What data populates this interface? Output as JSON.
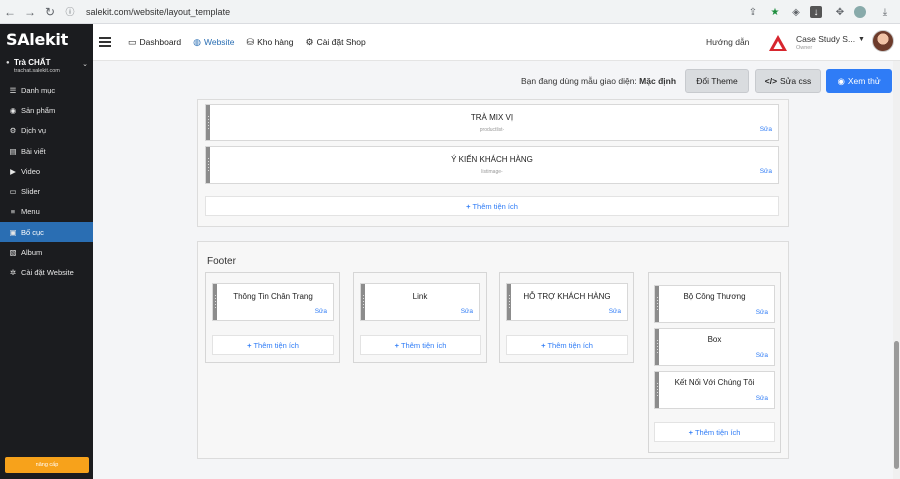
{
  "browser": {
    "url": "salekit.com/website/layout_template"
  },
  "sidebar": {
    "logo": "SAlekit",
    "shop_name": "Trà CHẤT",
    "shop_domain": "trachat.salekit.com",
    "items": [
      {
        "label": "Danh mục",
        "icon": "list-icon"
      },
      {
        "label": "Sản phẩm",
        "icon": "box-icon"
      },
      {
        "label": "Dịch vụ",
        "icon": "gear-icon"
      },
      {
        "label": "Bài viết",
        "icon": "document-icon"
      },
      {
        "label": "Video",
        "icon": "video-icon"
      },
      {
        "label": "Slider",
        "icon": "slider-icon"
      },
      {
        "label": "Menu",
        "icon": "menu-icon"
      },
      {
        "label": "Bố cục",
        "icon": "layout-icon",
        "active": true
      },
      {
        "label": "Album",
        "icon": "image-icon"
      },
      {
        "label": "Cài đặt Website",
        "icon": "settings-icon"
      }
    ],
    "upgrade_label": "nâng cấp"
  },
  "topbar": {
    "nav": [
      {
        "label": "Dashboard",
        "icon": "monitor-icon"
      },
      {
        "label": "Website",
        "icon": "globe-icon",
        "active": true
      },
      {
        "label": "Kho hàng",
        "icon": "database-icon"
      },
      {
        "label": "Cài đặt Shop",
        "icon": "gear-icon"
      }
    ],
    "help": "Hướng dẫn",
    "account_name": "Case Study S...",
    "account_role": "Owner"
  },
  "theme": {
    "label": "Bạn đang dùng mẫu giao diện:",
    "current": "Mặc định",
    "change_theme": "Đổi Theme",
    "edit_css": "Sửa css",
    "preview": "Xem thử"
  },
  "body_section": {
    "widgets": [
      {
        "title": "TRÀ MIX VỊ",
        "sub": "productlist-",
        "edit": "Sửa"
      },
      {
        "title": "Ý KIẾN KHÁCH HÀNG",
        "sub": "listimage-",
        "edit": "Sửa"
      }
    ],
    "add_label": "Thêm tiện ích"
  },
  "footer": {
    "label": "Footer",
    "columns": [
      {
        "widgets": [
          {
            "title": "Thông Tin Chân Trang",
            "edit": "Sửa"
          }
        ],
        "add_label": "Thêm tiện ích"
      },
      {
        "widgets": [
          {
            "title": "Link",
            "edit": "Sửa"
          }
        ],
        "add_label": "Thêm tiện ích"
      },
      {
        "widgets": [
          {
            "title": "HỖ TRỢ KHÁCH HÀNG",
            "edit": "Sửa"
          }
        ],
        "add_label": "Thêm tiện ích"
      },
      {
        "widgets": [
          {
            "title": "Bộ Công Thương",
            "edit": "Sửa"
          },
          {
            "title": "Box",
            "edit": "Sửa"
          },
          {
            "title": "Kết Nối Với Chúng Tôi",
            "edit": "Sửa"
          }
        ],
        "add_label": "Thêm tiện ích"
      }
    ]
  },
  "colors": {
    "accent": "#2f7cf6",
    "sidebar_bg": "#1b1c1f",
    "sidebar_active": "#2a6eb3",
    "upgrade": "#f7a21b"
  }
}
